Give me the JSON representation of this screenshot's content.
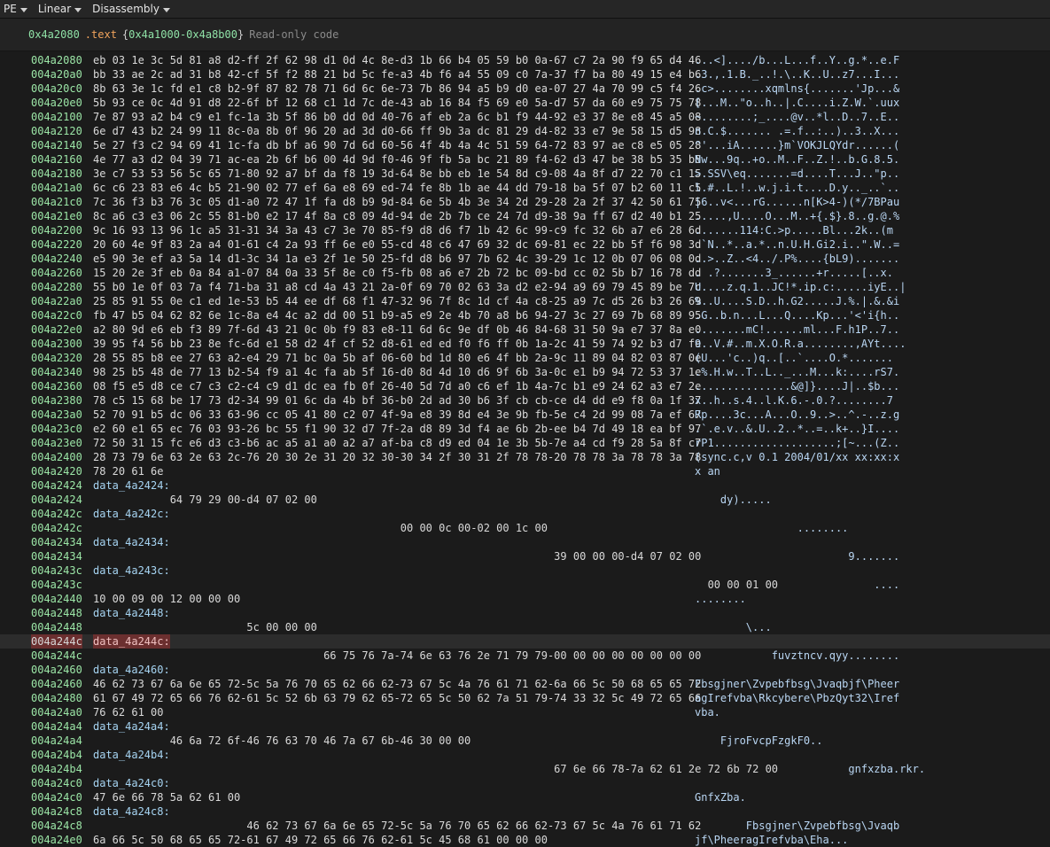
{
  "toolbar": {
    "view_type": "PE",
    "layout": "Linear",
    "mode": "Disassembly"
  },
  "header": {
    "address": "0x4a2080",
    "section": ".text",
    "range": "0x4a1000-0x4a8b00",
    "permissions": "Read-only code"
  },
  "lines": [
    {
      "addr": "004a2080",
      "bytes": "eb 03 1e 3c 5d 81 a8 d2-ff 2f 62 98 d1 0d 4c 8e-d3 1b 66 b4 05 59 b0 0a-67 c7 2a 90 f9 65 d4 46",
      "text": "...<]..../b...L...f..Y..g.*..e.F"
    },
    {
      "addr": "004a20a0",
      "bytes": "bb 33 ae 2c ad 31 b8 42-cf 5f f2 88 21 bd 5c fe-a3 4b f6 a4 55 09 c0 7a-37 f7 ba 80 49 15 e4 b6",
      "text": ".3.,.1.B._..!.\\..K..U..z7...I..."
    },
    {
      "addr": "004a20c0",
      "bytes": "8b 63 3e 1c fd e1 c8 b2-9f 87 82 78 71 6d 6c 6e-73 7b 86 94 a5 b9 d0 ea-07 27 4a 70 99 c5 f4 26",
      "text": ".c>........xqmlns{.......'Jp...&"
    },
    {
      "addr": "004a20e0",
      "bytes": "5b 93 ce 0c 4d 91 d8 22-6f bf 12 68 c1 1d 7c de-43 ab 16 84 f5 69 e0 5a-d7 57 da 60 e9 75 75 78",
      "text": "[...M..\"o..h..|.C....i.Z.W.`.uux"
    },
    {
      "addr": "004a2100",
      "bytes": "7e 87 93 a2 b4 c9 e1 fc-1a 3b 5f 86 b0 dd 0d 40-76 af eb 2a 6c b1 f9 44-92 e3 37 8e e8 45 a5 08",
      "text": "~........;_....@v..*l..D..7..E.."
    },
    {
      "addr": "004a2120",
      "bytes": "6e d7 43 b2 24 99 11 8c-0a 8b 0f 96 20 ad 3d d0-66 ff 9b 3a dc 81 29 d4-82 33 e7 9e 58 15 d5 98",
      "text": "n.C.$....... .=.f..:..)..3..X..."
    },
    {
      "addr": "004a2140",
      "bytes": "5e 27 f3 c2 94 69 41 1c-fa db bf a6 90 7d 6d 60-56 4f 4b 4a 4c 51 59 64-72 83 97 ae c8 e5 05 28",
      "text": "^'...iA......}m`VOKJLQYdr......("
    },
    {
      "addr": "004a2160",
      "bytes": "4e 77 a3 d2 04 39 71 ac-ea 2b 6f b6 00 4d 9d f0-46 9f fb 5a bc 21 89 f4-62 d3 47 be 38 b5 35 b8",
      "text": "Nw...9q..+o..M..F..Z.!..b.G.8.5."
    },
    {
      "addr": "004a2180",
      "bytes": "3e c7 53 53 56 5c 65 71-80 92 a7 bf da f8 19 3d-64 8e bb eb 1e 54 8d c9-08 4a 8f d7 22 70 c1 15",
      "text": ">.SSV\\eq.......=d....T...J..\"p.."
    },
    {
      "addr": "004a21a0",
      "bytes": "6c c6 23 83 e6 4c b5 21-90 02 77 ef 6a e8 69 ed-74 fe 8b 1b ae 44 dd 79-18 ba 5f 07 b2 60 11 c5",
      "text": "l.#..L.!..w.j.i.t....D.y.._..`.."
    },
    {
      "addr": "004a21c0",
      "bytes": "7c 36 f3 b3 76 3c 05 d1-a0 72 47 1f fa d8 b9 9d-84 6e 5b 4b 3e 34 2d 29-28 2a 2f 37 42 50 61 75",
      "text": "|6..v<...rG......n[K>4-)(*/7BPau"
    },
    {
      "addr": "004a21e0",
      "bytes": "8c a6 c3 e3 06 2c 55 81-b0 e2 17 4f 8a c8 09 4d-94 de 2b 7b ce 24 7d d9-38 9a ff 67 d2 40 b1 25",
      "text": ".....,U....O...M..+{.$}.8..g.@.%"
    },
    {
      "addr": "004a2200",
      "bytes": "9c 16 93 13 96 1c a5 31-31 34 3a 43 c7 3e 70 85-f9 d8 d6 f7 1b 42 6c 99-c9 fc 32 6b a7 e6 28 6d",
      "text": ".......114:C.>p.....Bl...2k..(m"
    },
    {
      "addr": "004a2220",
      "bytes": "20 60 4e 9f 83 2a a4 01-61 c4 2a 93 ff 6e e0 55-cd 48 c6 47 69 32 dc 69-81 ec 22 bb 5f f6 98 3d",
      "text": " `N..*..a.*..n.U.H.Gi2.i..\".W..="
    },
    {
      "addr": "004a2240",
      "bytes": "e5 90 3e ef a3 5a 14 d1-3c 34 1a e3 2f 1e 50 25-fd d8 b6 97 7b 62 4c 39-29 1c 12 0b 07 06 08 0d",
      "text": "..>..Z..<4../.P%....{bL9)......."
    },
    {
      "addr": "004a2260",
      "bytes": "15 20 2e 3f eb 0a 84 a1-07 84 0a 33 5f 8e c0 f5-fb 08 a6 e7 2b 72 bc 09-bd cc 02 5b b7 16 78 dd",
      "text": ". .?.......3_......+r.....[..x."
    },
    {
      "addr": "004a2280",
      "bytes": "55 b0 1e 0f 03 7a f4 71-ba 31 a8 cd 4a 43 21 2a-0f 69 70 02 63 3a d2 e2-94 a9 69 79 45 89 be 7c",
      "text": "U....z.q.1..JC!*.ip.c:.....iyE..|"
    },
    {
      "addr": "004a22a0",
      "bytes": "25 85 91 55 0e c1 ed 1e-53 b5 44 ee df 68 f1 47-32 96 7f 8c 1d cf 4a c8-25 a9 7c d5 26 b3 26 69",
      "text": "%..U....S.D..h.G2.....J.%.|.&.&i"
    },
    {
      "addr": "004a22c0",
      "bytes": "fb 47 b5 04 62 82 6e 1c-8a e4 4c a2 dd 00 51 b9-a5 e9 2e 4b 70 a8 b6 94-27 3c 27 69 7b 68 89 95",
      "text": ".G..b.n...L...Q....Kp...'<'i{h.."
    },
    {
      "addr": "004a22e0",
      "bytes": "a2 80 9d e6 eb f3 89 7f-6d 43 21 0c 0b f9 83 e8-11 6d 6c 9e df 0b 46 84-68 31 50 9a e7 37 8a e0",
      "text": "........mC!......ml...F.h1P..7.."
    },
    {
      "addr": "004a2300",
      "bytes": "39 95 f4 56 bb 23 8e fc-6d e1 58 d2 4f cf 52 d8-61 ed ed f0 f6 ff 0b 1a-2c 41 59 74 92 b3 d7 fe",
      "text": "9..V.#..m.X.O.R.a........,AYt...."
    },
    {
      "addr": "004a2320",
      "bytes": "28 55 85 b8 ee 27 63 a2-e4 29 71 bc 0a 5b af 06-60 bd 1d 80 e6 4f bb 2a-9c 11 89 04 82 03 87 0e",
      "text": "(U...'c..)q..[..`....O.*......."
    },
    {
      "addr": "004a2340",
      "bytes": "98 25 b5 48 de 77 13 b2-54 f9 a1 4c fa ab 5f 16-d0 8d 4d 10 d6 9f 6b 3a-0c e1 b9 94 72 53 37 1e",
      "text": ".%.H.w..T..L.._...M...k:....rS7."
    },
    {
      "addr": "004a2360",
      "bytes": "08 f5 e5 d8 ce c7 c3 c2-c4 c9 d1 dc ea fb 0f 26-40 5d 7d a0 c6 ef 1b 4a-7c b1 e9 24 62 a3 e7 2e",
      "text": "...............&@]}....J|..$b..."
    },
    {
      "addr": "004a2380",
      "bytes": "78 c5 15 68 be 17 73 d2-34 99 01 6c da 4b bf 36-b0 2d ad 30 b6 3f cb cb-ce d4 dd e9 f8 0a 1f 37",
      "text": "x..h..s.4..l.K.6.-.0.?........7"
    },
    {
      "addr": "004a23a0",
      "bytes": "52 70 91 b5 dc 06 33 63-96 cc 05 41 80 c2 07 4f-9a e8 39 8d e4 3e 9b fb-5e c4 2d 99 08 7a ef 67",
      "text": "Rp....3c...A...O..9..>..^.-..z.g"
    },
    {
      "addr": "004a23c0",
      "bytes": "e2 60 e1 65 ec 76 03 93-26 bc 55 f1 90 32 d7 7f-2a d8 89 3d f4 ae 6b 2b-ee b4 7d 49 18 ea bf 97",
      "text": ".`.e.v..&.U..2..*..=..k+..}I...."
    },
    {
      "addr": "004a23e0",
      "bytes": "72 50 31 15 fc e6 d3 c3-b6 ac a5 a1 a0 a2 a7 af-ba c8 d9 ed 04 1e 3b 5b-7e a4 cd f9 28 5a 8f c7",
      "text": "rP1...................;[~...(Z.."
    },
    {
      "addr": "004a2400",
      "bytes": "28 73 79 6e 63 2e 63 2c-76 20 30 2e 31 20 32 30-30 34 2f 30 31 2f 78 78-20 78 78 3a 78 78 3a 78",
      "text": "(sync.c,v 0.1 2004/01/xx xx:xx:x"
    },
    {
      "addr": "004a2420",
      "bytes": "78 20 61 6e",
      "text": "x an"
    },
    {
      "addr": "004a2424",
      "label": "data_4a2424:"
    },
    {
      "addr": "004a2424",
      "bytes": "            64 79 29 00-d4 07 02 00",
      "text": "    dy)....."
    },
    {
      "addr": "004a242c",
      "label": "data_4a242c:"
    },
    {
      "addr": "004a242c",
      "bytes": "                                                00 00 0c 00-02 00 1c 00",
      "text": "                ........"
    },
    {
      "addr": "004a2434",
      "label": "data_4a2434:"
    },
    {
      "addr": "004a2434",
      "bytes": "                                                                        39 00 00 00-d4 07 02 00",
      "text": "                        9......."
    },
    {
      "addr": "004a243c",
      "label": "data_4a243c:"
    },
    {
      "addr": "004a243c",
      "bytes": "                                                                                                00 00 01 00",
      "text": "                            ...."
    },
    {
      "addr": "004a2440",
      "bytes": "10 00 09 00 12 00 00 00",
      "text": "........"
    },
    {
      "addr": "004a2448",
      "label": "data_4a2448:"
    },
    {
      "addr": "004a2448",
      "bytes": "                        5c 00 00 00",
      "text": "        \\..."
    },
    {
      "addr": "004a244c",
      "label": "data_4a244c:",
      "selected": true
    },
    {
      "addr": "004a244c",
      "bytes": "                                    66 75 76 7a-74 6e 63 76 2e 71 79 79-00 00 00 00 00 00 00 00",
      "text": "            fuvztncv.qyy........"
    },
    {
      "addr": "004a2460",
      "label": "data_4a2460:"
    },
    {
      "addr": "004a2460",
      "bytes": "46 62 73 67 6a 6e 65 72-5c 5a 76 70 65 62 66 62-73 67 5c 4a 76 61 71 62-6a 66 5c 50 68 65 65 72",
      "text": "Fbsgjner\\Zvpebfbsg\\Jvaqbjf\\Pheer"
    },
    {
      "addr": "004a2480",
      "bytes": "61 67 49 72 65 66 76 62-61 5c 52 6b 63 79 62 65-72 65 5c 50 62 7a 51 79-74 33 32 5c 49 72 65 66",
      "text": "agIrefvba\\Rkcybere\\PbzQyt32\\Iref"
    },
    {
      "addr": "004a24a0",
      "bytes": "76 62 61 00",
      "text": "vba."
    },
    {
      "addr": "004a24a4",
      "label": "data_4a24a4:"
    },
    {
      "addr": "004a24a4",
      "bytes": "            46 6a 72 6f-46 76 63 70 46 7a 67 6b-46 30 00 00",
      "text": "    FjroFvcpFzgkF0.."
    },
    {
      "addr": "004a24b4",
      "label": "data_4a24b4:"
    },
    {
      "addr": "004a24b4",
      "bytes": "                                                                        67 6e 66 78-7a 62 61 2e 72 6b 72 00",
      "text": "                        gnfxzba.rkr."
    },
    {
      "addr": "004a24c0",
      "label": "data_4a24c0:"
    },
    {
      "addr": "004a24c0",
      "bytes": "47 6e 66 78 5a 62 61 00",
      "text": "GnfxZba."
    },
    {
      "addr": "004a24c8",
      "label": "data_4a24c8:"
    },
    {
      "addr": "004a24c8",
      "bytes": "                        46 62 73 67 6a 6e 65 72-5c 5a 76 70 65 62 66 62-73 67 5c 4a 76 61 71 62",
      "text": "        Fbsgjner\\Zvpebfbsg\\Jvaqb"
    },
    {
      "addr": "004a24e0",
      "bytes": "6a 66 5c 50 68 65 65 72-61 67 49 72 65 66 76 62-61 5c 45 68 61 00 00 00",
      "text": "jf\\PheeragIrefvba\\Eha..."
    }
  ]
}
